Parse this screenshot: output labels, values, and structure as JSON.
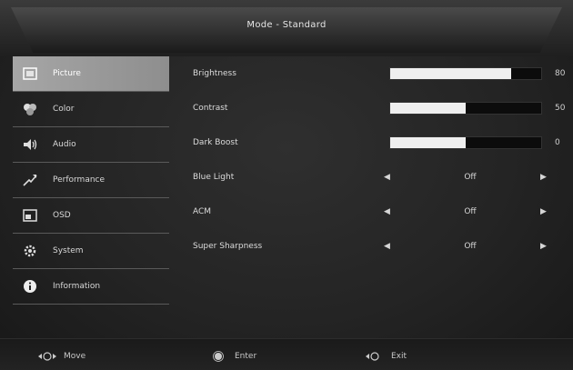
{
  "header": {
    "title": "Mode - Standard"
  },
  "sidebar": {
    "items": [
      {
        "label": "Picture",
        "icon": "picture-icon",
        "active": true
      },
      {
        "label": "Color",
        "icon": "color-palette-icon",
        "active": false
      },
      {
        "label": "Audio",
        "icon": "speaker-icon",
        "active": false
      },
      {
        "label": "Performance",
        "icon": "performance-arrow-icon",
        "active": false
      },
      {
        "label": "OSD",
        "icon": "osd-icon",
        "active": false
      },
      {
        "label": "System",
        "icon": "gear-icon",
        "active": false
      },
      {
        "label": "Information",
        "icon": "info-icon",
        "active": false
      }
    ]
  },
  "settings": {
    "brightness": {
      "label": "Brightness",
      "value": "80",
      "level": 0.8
    },
    "contrast": {
      "label": "Contrast",
      "value": "50",
      "level": 0.5
    },
    "dark_boost": {
      "label": "Dark Boost",
      "value": "0",
      "level": 0.5
    },
    "blue_light": {
      "label": "Blue Light",
      "value": "Off"
    },
    "acm": {
      "label": "ACM",
      "value": "Off"
    },
    "super_sharpness": {
      "label": "Super Sharpness",
      "value": "Off"
    }
  },
  "footer": {
    "move_label": "Move",
    "enter_label": "Enter",
    "exit_label": "Exit"
  }
}
